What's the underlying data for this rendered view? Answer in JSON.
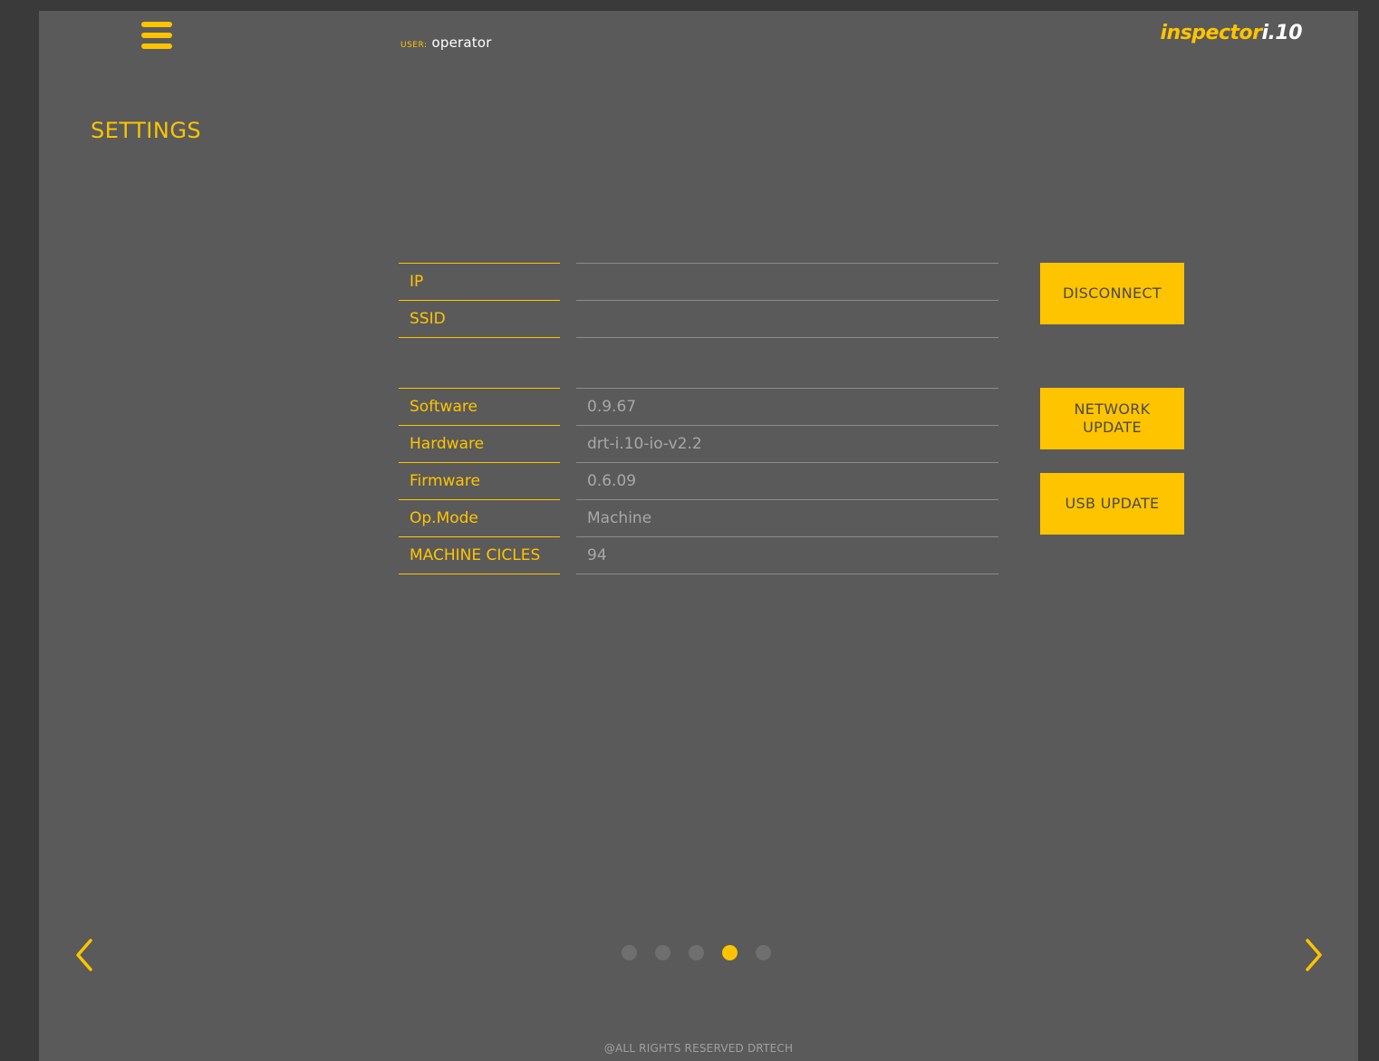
{
  "header": {
    "user_label": "USER:",
    "user_name": "operator",
    "logo_main": "inspector",
    "logo_version": "i.10"
  },
  "page": {
    "title": "SETTINGS"
  },
  "network": {
    "rows": [
      {
        "label": "IP",
        "value": ""
      },
      {
        "label": "SSID",
        "value": ""
      }
    ],
    "disconnect_label": "DISCONNECT"
  },
  "info": {
    "rows": [
      {
        "label": "Software",
        "value": "0.9.67"
      },
      {
        "label": "Hardware",
        "value": "drt-i.10-io-v2.2"
      },
      {
        "label": "Firmware",
        "value": "0.6.09"
      },
      {
        "label": "Op.Mode",
        "value": "Machine"
      },
      {
        "label": "MACHINE CICLES",
        "value": "94"
      }
    ],
    "network_update_label": "NETWORK UPDATE",
    "usb_update_label": "USB UPDATE"
  },
  "pagination": {
    "total": 5,
    "active_index": 3
  },
  "footer": {
    "text": "@ALL RIGHTS RESERVED DRTECH"
  },
  "colors": {
    "accent": "#ffc400",
    "background": "#5a5a5a",
    "frame": "#3a3a3a"
  },
  "icons": {
    "menu": "hamburger-menu-icon",
    "prev": "chevron-left-icon",
    "next": "chevron-right-icon"
  }
}
